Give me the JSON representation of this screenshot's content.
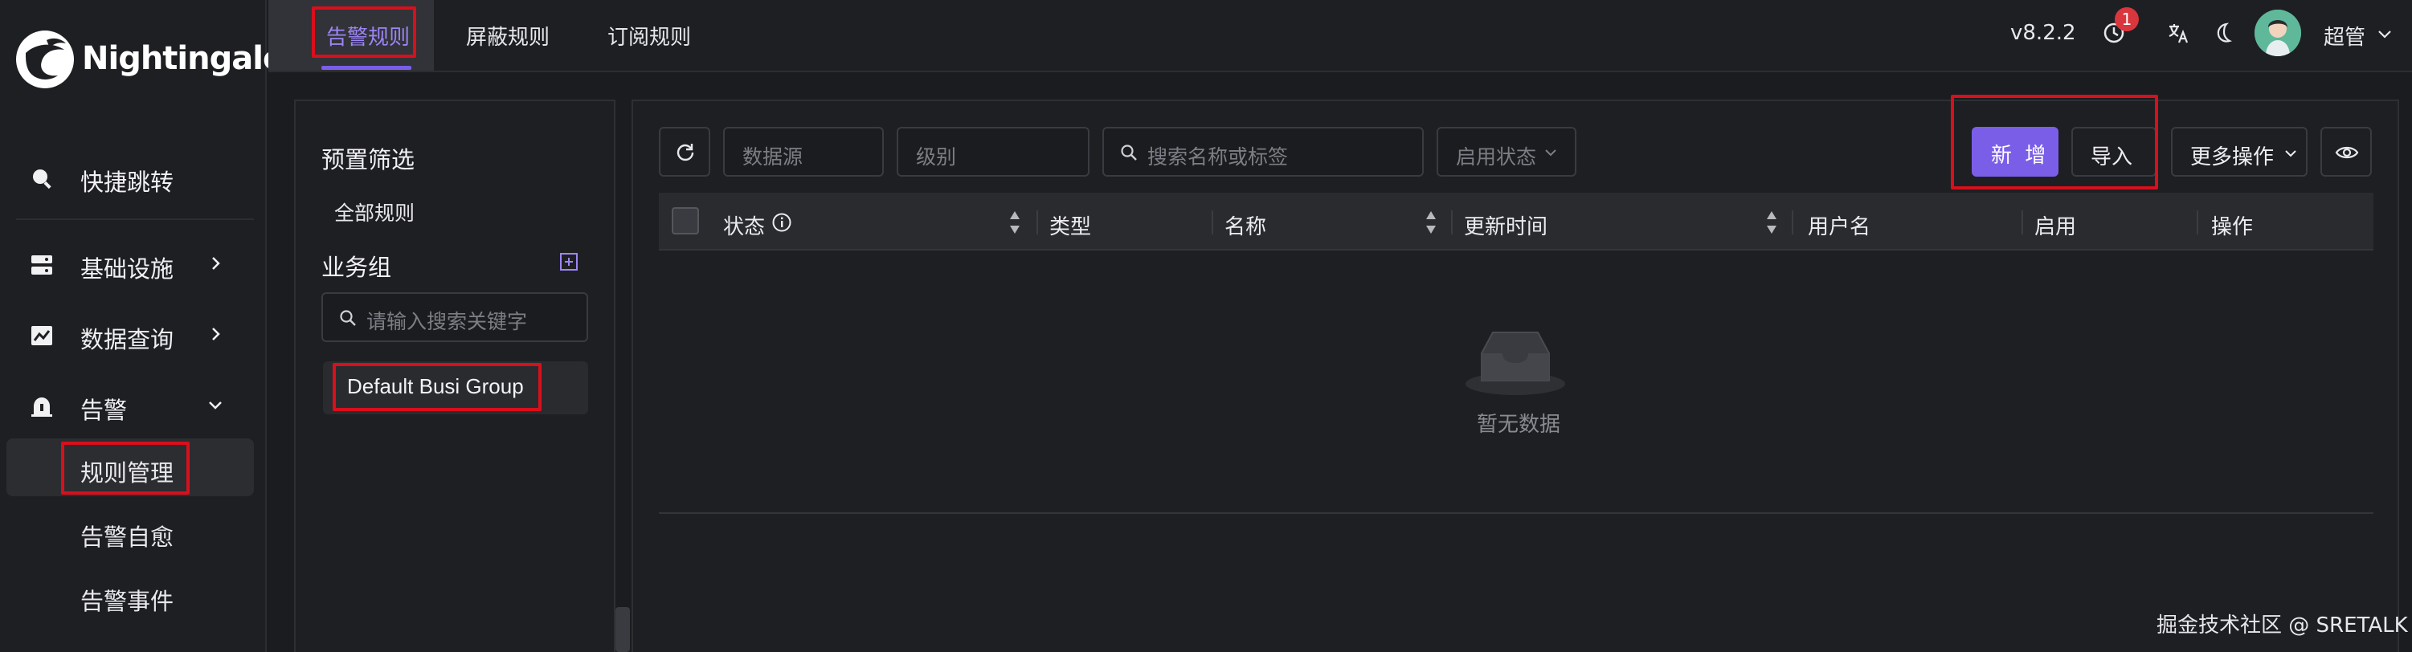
{
  "app": {
    "name": "Nightingale",
    "version": "v8.2.2",
    "brand_color": "#7b5ee8",
    "highlight_color": "#d90f1c"
  },
  "header": {
    "tabs": [
      {
        "label": "告警规则",
        "active": true
      },
      {
        "label": "屏蔽规则",
        "active": false
      },
      {
        "label": "订阅规则",
        "active": false
      }
    ],
    "notification_count": "1",
    "user_name": "超管",
    "icons": [
      "clock-icon",
      "translate-icon",
      "moon-icon",
      "avatar",
      "chevron-down-icon"
    ]
  },
  "sidebar": {
    "items": [
      {
        "label": "快捷跳转",
        "icon": "search-icon"
      },
      {
        "label": "基础设施",
        "icon": "server-icon",
        "expandable": true
      },
      {
        "label": "数据查询",
        "icon": "chart-icon",
        "expandable": true
      },
      {
        "label": "告警",
        "icon": "alarm-icon",
        "expanded": true
      }
    ],
    "sub_items": [
      {
        "label": "规则管理",
        "active": true
      },
      {
        "label": "告警自愈",
        "active": false
      },
      {
        "label": "告警事件",
        "active": false
      }
    ]
  },
  "filter_panel": {
    "preset_title": "预置筛选",
    "preset_all": "全部规则",
    "group_title": "业务组",
    "group_search_placeholder": "请输入搜索关键字",
    "groups": [
      "Default Busi Group"
    ]
  },
  "toolbar": {
    "datasource_placeholder": "数据源",
    "severity_placeholder": "级别",
    "search_placeholder": "搜索名称或标签",
    "status_placeholder": "启用状态",
    "add_label": "新 增",
    "import_label": "导入",
    "more_label": "更多操作"
  },
  "table": {
    "columns": [
      "状态",
      "类型",
      "名称",
      "更新时间",
      "用户名",
      "启用",
      "操作"
    ],
    "rows": [],
    "empty_text": "暂无数据"
  },
  "watermark": "掘金技术社区 @ SRETALK"
}
